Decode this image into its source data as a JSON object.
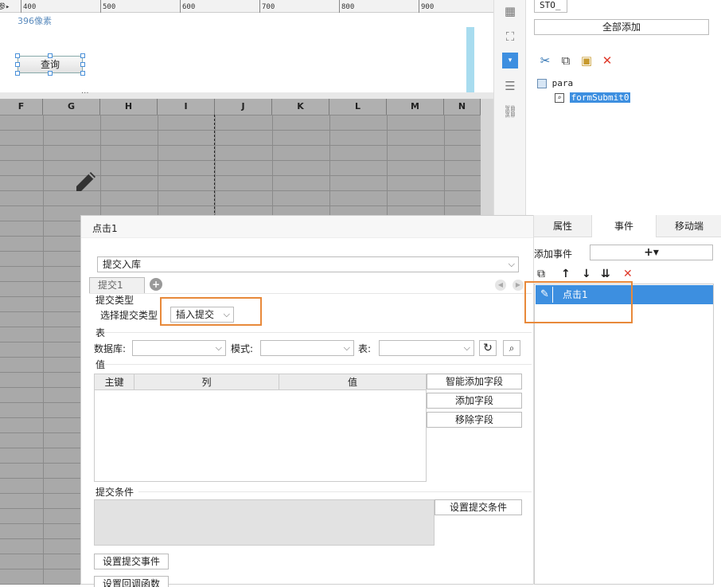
{
  "ruler": {
    "labels": [
      "400",
      "500",
      "600",
      "700",
      "800",
      "900"
    ],
    "corner": "参▸"
  },
  "canvas": {
    "pixel_note": "396像素",
    "query_button": "查询"
  },
  "grid": {
    "columns": [
      "F",
      "G",
      "H",
      "I",
      "J",
      "K",
      "L",
      "M",
      "N"
    ]
  },
  "right_top": {
    "sto_value": "STO_",
    "add_all": "全部添加",
    "tree": {
      "root": "para",
      "child": "formSubmit0"
    }
  },
  "dialog": {
    "title": "点击1",
    "submit_type_select": "提交入库",
    "tab": "提交1",
    "section_submit_type": "提交类型",
    "choose_submit_type_label": "选择提交类型",
    "submit_type_value": "插入提交",
    "section_table": "表",
    "db_label": "数据库:",
    "schema_label": "模式:",
    "table_label": "表:",
    "section_value": "值",
    "columns": [
      "主键",
      "列",
      "值"
    ],
    "smart_add": "智能添加字段",
    "add_field": "添加字段",
    "remove_field": "移除字段",
    "section_condition": "提交条件",
    "set_condition": "设置提交条件",
    "set_event": "设置提交事件",
    "set_callback": "设置回调函数"
  },
  "right_bottom": {
    "tabs": [
      "属性",
      "事件",
      "移动端"
    ],
    "add_event_label": "添加事件",
    "add_symbol": "+▾",
    "event_item": "点击1"
  },
  "colors": {
    "accent": "#3d8fe0",
    "highlight": "#e8893a",
    "delete": "#e03a2b"
  }
}
